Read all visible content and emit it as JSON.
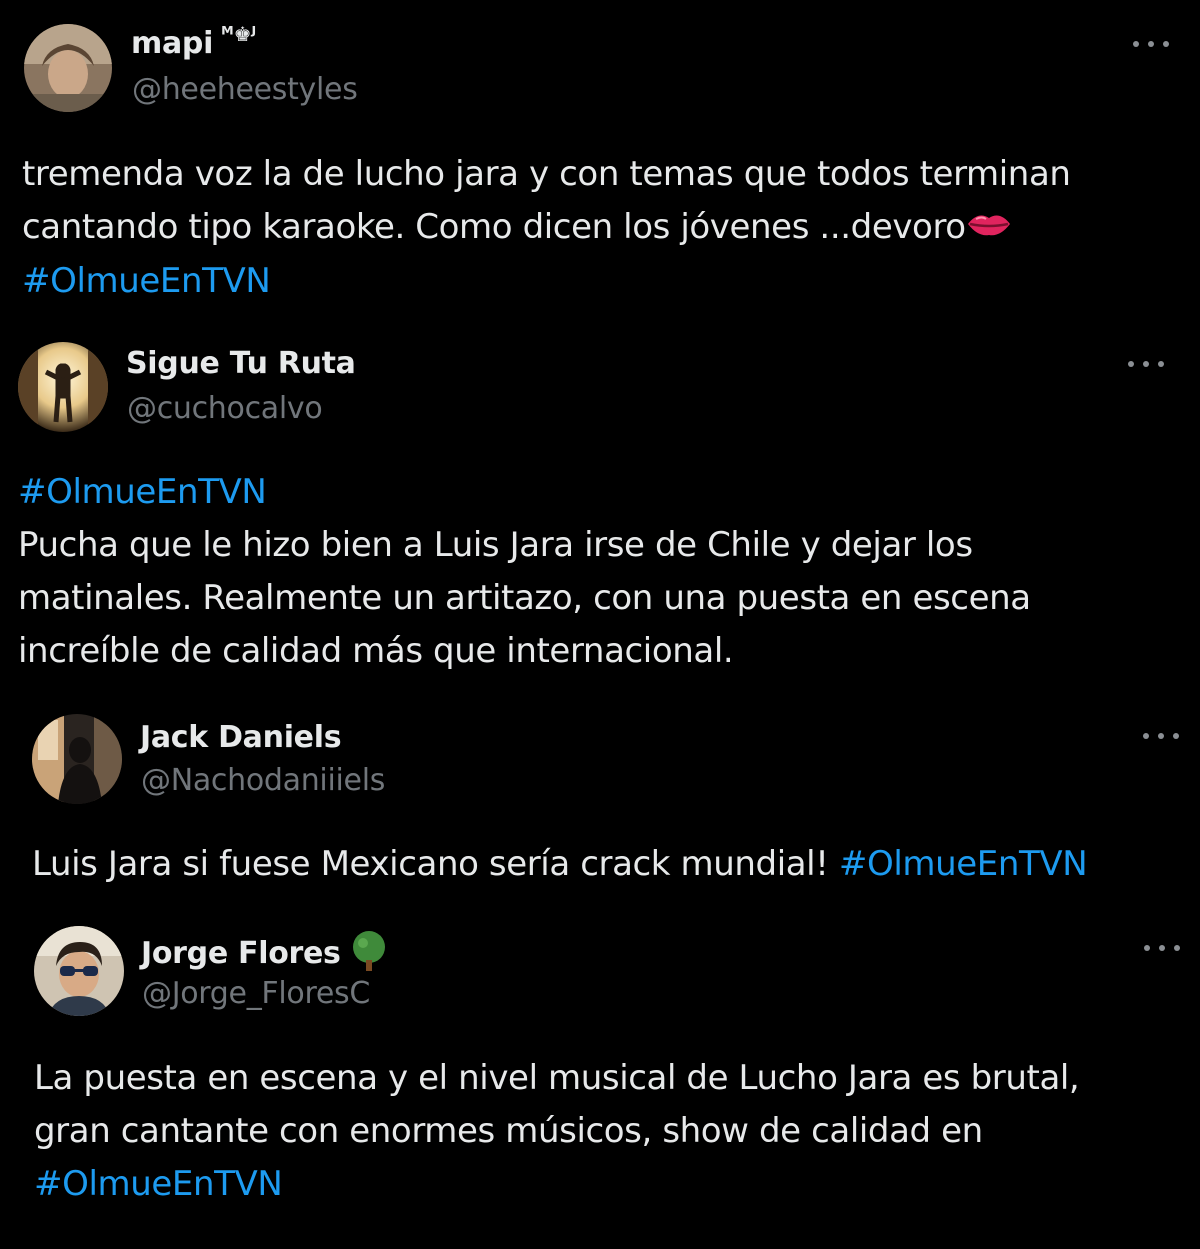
{
  "tweets": [
    {
      "display_name": "mapi",
      "badge": "ᴹ♚ᴶ",
      "handle": "@heeheestyles",
      "lines": [
        "tremenda voz la de lucho jara y con temas que todos terminan",
        "cantando tipo karaoke. Como dicen los jóvenes ...devoro"
      ],
      "emoji": "lips-kiss-icon",
      "hashtag": "#OlmueEnTVN"
    },
    {
      "display_name": "Sigue Tu Ruta",
      "handle": "@cuchocalvo",
      "hashtag": "#OlmueEnTVN",
      "lines": [
        "Pucha que le hizo bien a Luis Jara irse de Chile y dejar los",
        "matinales. Realmente un artitazo, con una puesta en escena",
        "increíble de calidad más que internacional."
      ]
    },
    {
      "display_name": "Jack Daniels",
      "handle": "@Nachodaniiiels",
      "text": "Luis Jara si fuese Mexicano sería crack mundial!",
      "hashtag": "#OlmueEnTVN"
    },
    {
      "display_name": "Jorge Flores",
      "name_emoji": "tree-icon",
      "handle": "@Jorge_FloresC",
      "lines": [
        "La puesta en escena y el nivel musical de Lucho Jara es brutal,",
        "gran cantante con enormes músicos, show de calidad en"
      ],
      "hashtag": "#OlmueEnTVN"
    }
  ],
  "colors": {
    "background": "#000000",
    "text": "#e7e9ea",
    "handle": "#71767b",
    "hashtag": "#1d9bf0"
  }
}
